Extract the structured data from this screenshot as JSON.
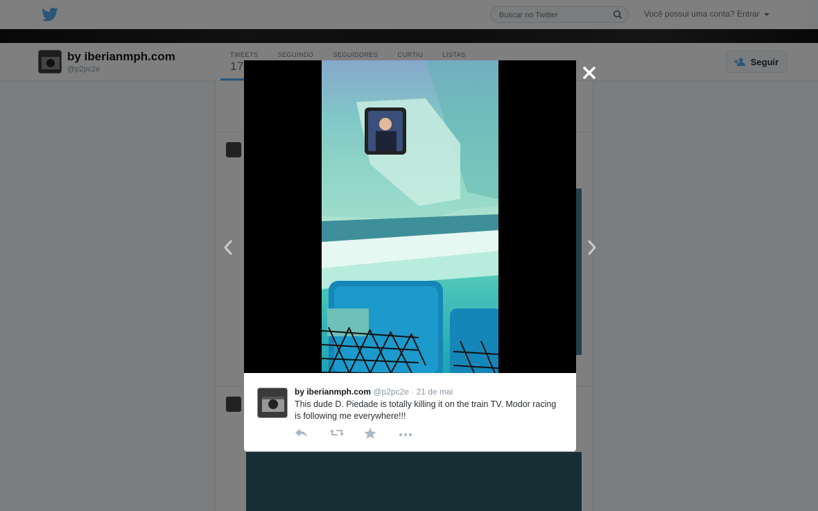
{
  "header": {
    "search_placeholder": "Buscar no Twitter",
    "login_text": "Você possui uma conta? Entrar"
  },
  "profile": {
    "name": "by iberianmph.com",
    "handle": "@p2pc2e",
    "follow_label": "Seguir",
    "nav": [
      {
        "label": "TWEETS",
        "count": "17"
      },
      {
        "label": "SEGUINDO",
        "count": ""
      },
      {
        "label": "SEGUIDORES",
        "count": ""
      },
      {
        "label": "CURTIU",
        "count": ""
      },
      {
        "label": "LISTAS",
        "count": ""
      }
    ]
  },
  "modal": {
    "tweet": {
      "name": "by iberianmph.com",
      "handle": "@p2pc2e",
      "date": "· 21 de mai",
      "text": "This dude D. Piedade is totally killing it on the train TV. Modor racing is following me everywhere!!!"
    },
    "icons": [
      "close-icon",
      "chevron-left-icon",
      "chevron-right-icon",
      "reply-icon",
      "retweet-icon",
      "favorite-icon",
      "more-icon"
    ]
  },
  "colors": {
    "accent": "#55acee",
    "overlay": "rgba(0,0,0,0.5)"
  }
}
